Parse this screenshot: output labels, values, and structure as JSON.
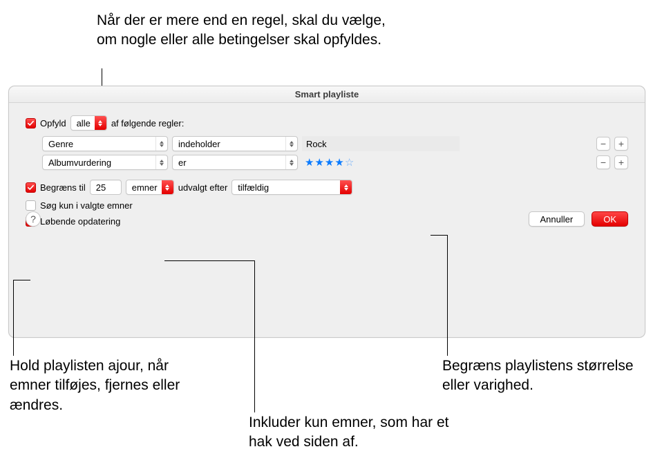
{
  "annotations": {
    "top": "Når der er mere end en regel, skal du vælge, om nogle eller alle betingelser skal opfyldes.",
    "bottom_left": "Hold playlisten ajour, når emner tilføjes, fjernes eller ændres.",
    "bottom_center": "Inkluder kun emner, som har et hak ved siden af.",
    "bottom_right": "Begræns playlistens størrelse eller varighed."
  },
  "dialog": {
    "title": "Smart playliste",
    "match": {
      "prefix": "Opfyld",
      "mode": "alle",
      "suffix": "af følgende regler:"
    },
    "rules": [
      {
        "field": "Genre",
        "operator": "indeholder",
        "value": "Rock",
        "type": "text"
      },
      {
        "field": "Albumvurdering",
        "operator": "er",
        "value": 4,
        "max": 5,
        "type": "rating"
      }
    ],
    "limit": {
      "label": "Begræns til",
      "value": "25",
      "unit": "emner",
      "selected_by_label": "udvalgt efter",
      "selected_by": "tilfældig"
    },
    "only_checked": {
      "label": "Søg kun i valgte emner",
      "checked": false
    },
    "live_update": {
      "label": "Løbende opdatering",
      "checked": true
    },
    "buttons": {
      "cancel": "Annuller",
      "ok": "OK"
    }
  }
}
